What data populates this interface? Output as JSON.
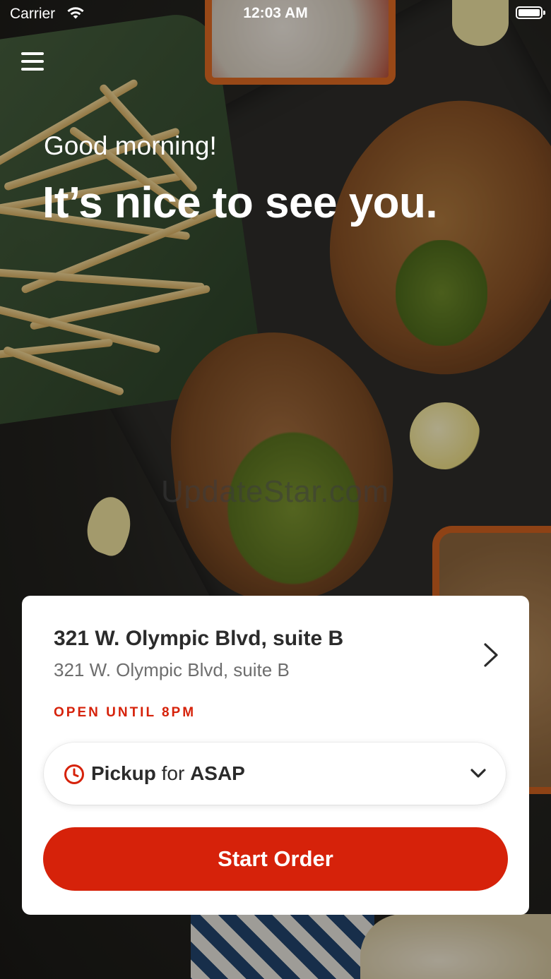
{
  "status_bar": {
    "carrier": "Carrier",
    "time": "12:03 AM",
    "battery_level": 1.0
  },
  "header": {
    "menu_icon": "hamburger-menu-icon",
    "greeting": "Good morning!",
    "headline": "It’s nice to see you."
  },
  "watermark": "UpdateStar.com",
  "location": {
    "name": "321 W. Olympic Blvd, suite B",
    "address": "321 W. Olympic Blvd, suite B",
    "hours": "OPEN UNTIL 8PM",
    "chevron_icon": "chevron-right-icon"
  },
  "order_mode": {
    "clock_icon": "clock-icon",
    "mode": "Pickup",
    "connector": "for",
    "time": "ASAP",
    "dropdown_icon": "chevron-down-icon"
  },
  "cta": {
    "start_order": "Start Order"
  },
  "colors": {
    "accent_red": "#d6220a",
    "card_bg": "#ffffff",
    "title_text": "#2b2b2b",
    "secondary_text": "#6e6e6e"
  }
}
